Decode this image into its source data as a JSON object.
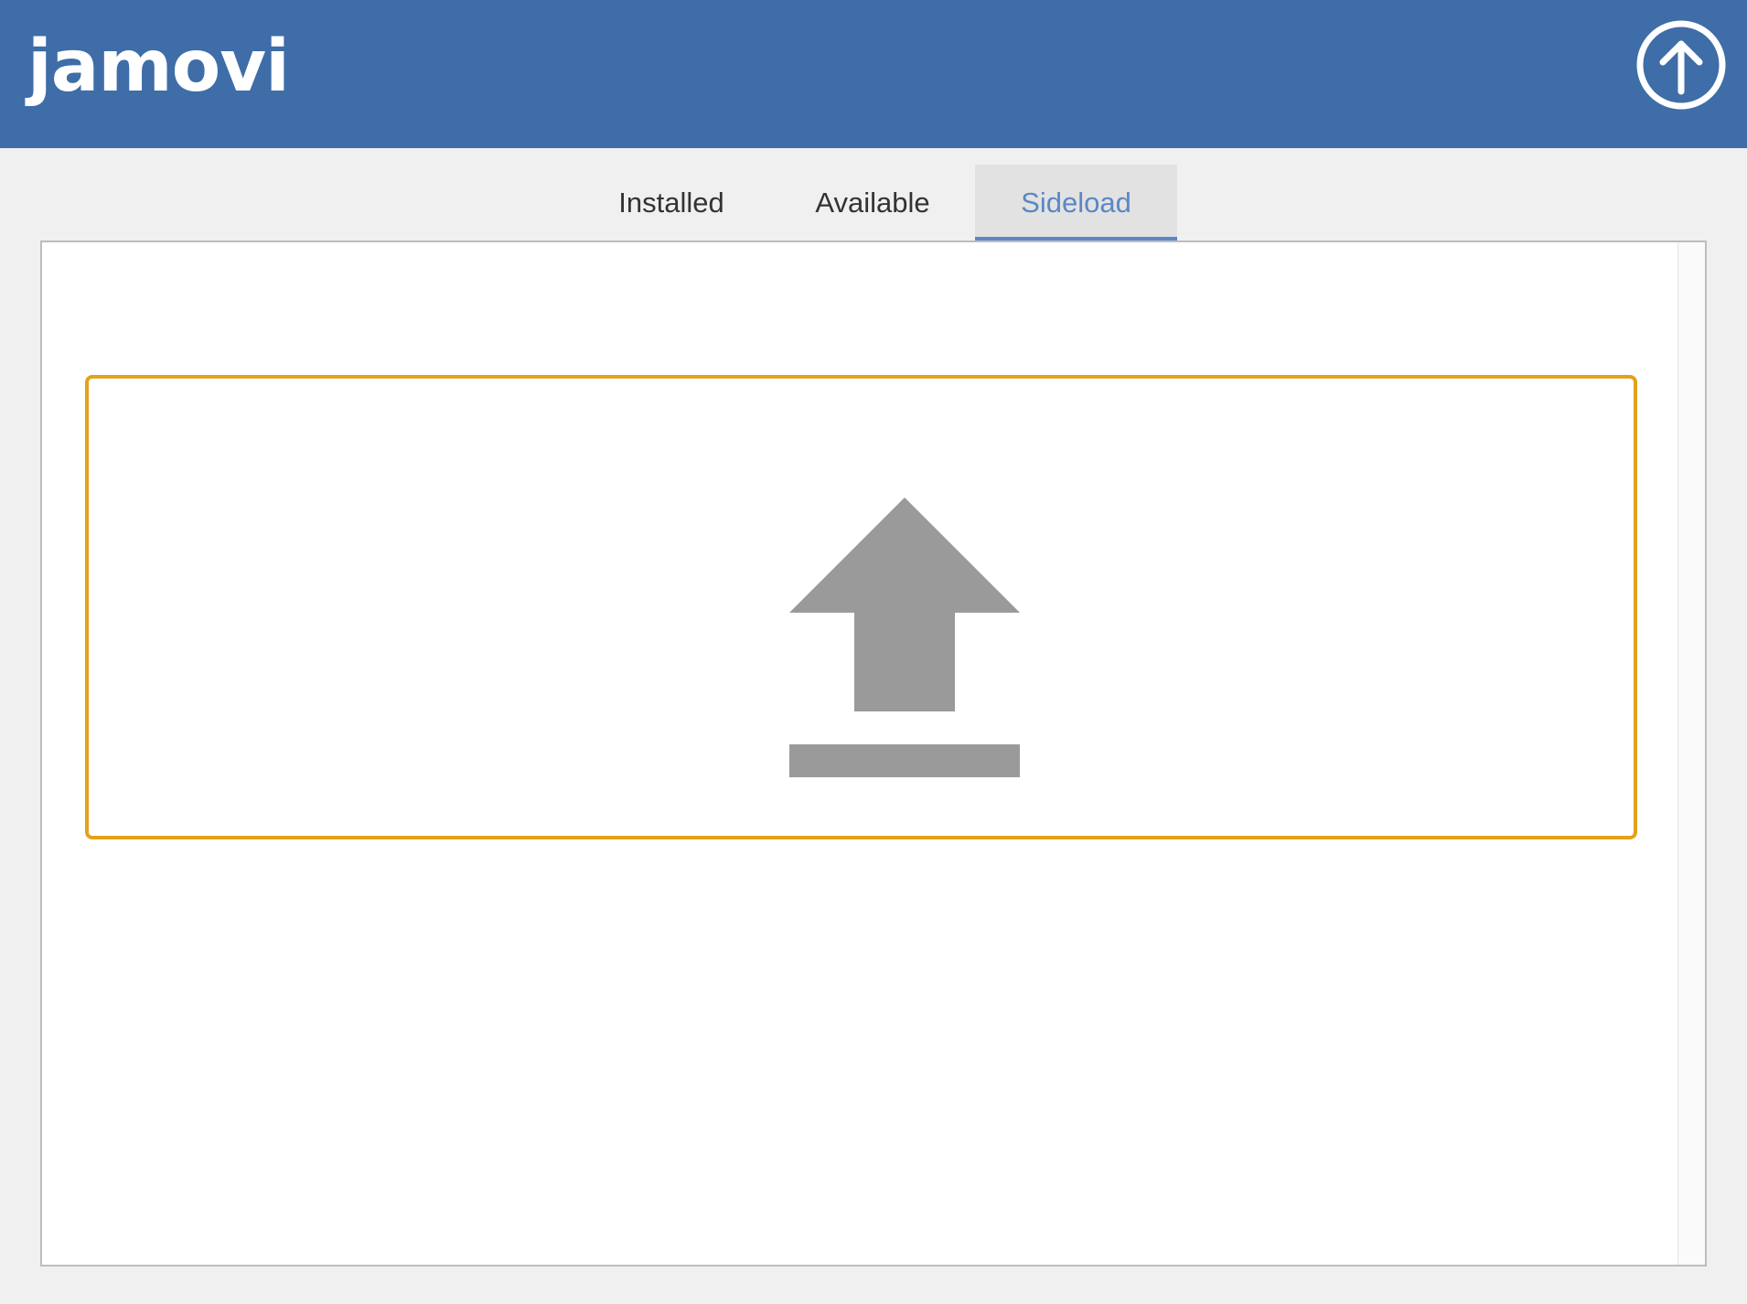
{
  "header": {
    "logo_text": "jamovi",
    "back_button_icon": "arrow-up-circle-icon"
  },
  "tabs": [
    {
      "label": "Installed",
      "active": false
    },
    {
      "label": "Available",
      "active": false
    },
    {
      "label": "Sideload",
      "active": true
    }
  ],
  "sideload": {
    "drop_zone_icon": "upload-icon"
  },
  "colors": {
    "header_bg": "#3e6da8",
    "accent": "#5b87c5",
    "drop_zone_border": "#e4a11b",
    "icon_gray": "#9a9a9a"
  }
}
